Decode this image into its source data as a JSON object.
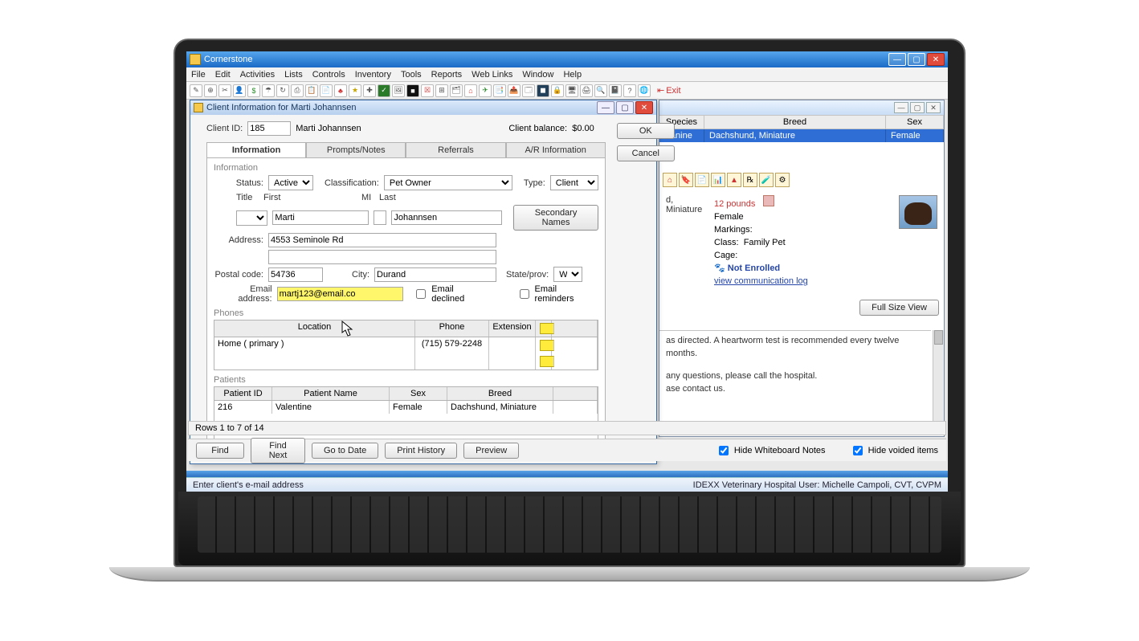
{
  "app": {
    "title": "Cornerstone"
  },
  "menu": [
    "File",
    "Edit",
    "Activities",
    "Lists",
    "Controls",
    "Inventory",
    "Tools",
    "Reports",
    "Web Links",
    "Window",
    "Help"
  ],
  "toolbar": {
    "exit": "Exit"
  },
  "child_window": {
    "columns": [
      "Species",
      "Breed",
      "Sex"
    ],
    "row": {
      "species": "Canine",
      "breed": "Dachshund, Miniature",
      "sex": "Female"
    },
    "breed_fragment": "d, Miniature",
    "pet": {
      "weight": "12 pounds",
      "sex": "Female",
      "markings_label": "Markings:",
      "class_label": "Class:",
      "class_value": "Family Pet",
      "cage_label": "Cage:",
      "not_enrolled": "Not Enrolled",
      "comm_log": "view communication log"
    },
    "full_size": "Full Size View",
    "notes": {
      "line1": "as directed.  A heartworm test is recommended every twelve months.",
      "line2": "any questions, please call the hospital.",
      "line3": "ase contact us."
    }
  },
  "dialog": {
    "title": "Client Information for Marti Johannsen",
    "client_id_label": "Client ID:",
    "client_id": "185",
    "client_name": "Marti Johannsen",
    "balance_label": "Client balance:",
    "balance_value": "$0.00",
    "ok": "OK",
    "cancel": "Cancel",
    "tabs": [
      "Information",
      "Prompts/Notes",
      "Referrals",
      "A/R Information"
    ],
    "info_legend": "Information",
    "status_label": "Status:",
    "status_value": "Active",
    "class_label": "Classification:",
    "class_value": "Pet Owner",
    "type_label": "Type:",
    "type_value": "Client",
    "title_label": "Title",
    "first_label": "First",
    "mi_label": "MI",
    "last_label": "Last",
    "first": "Marti",
    "mi": "",
    "last": "Johannsen",
    "secondary_names": "Secondary Names",
    "address_label": "Address:",
    "address1": "4553 Seminole Rd",
    "address2": "",
    "postal_label": "Postal code:",
    "postal": "54736",
    "city_label": "City:",
    "city": "Durand",
    "state_label": "State/prov:",
    "state": "WI",
    "email_label": "Email address:",
    "email": "martj123@email.co",
    "email_declined": "Email declined",
    "email_reminders": "Email reminders",
    "phones_legend": "Phones",
    "phones_cols": [
      "Location",
      "Phone",
      "Extension"
    ],
    "phones": [
      {
        "location": "Home  ( primary )",
        "phone": "(715) 579-2248",
        "ext": ""
      }
    ],
    "patients_legend": "Patients",
    "patients_cols": [
      "Patient ID",
      "Patient Name",
      "Sex",
      "Breed"
    ],
    "patients": [
      {
        "id": "216",
        "name": "Valentine",
        "sex": "Female",
        "breed": "Dachshund, Miniature"
      }
    ]
  },
  "footer": {
    "rows": "Rows 1 to 7 of 14",
    "find": "Find",
    "find_next": "Find Next",
    "go_to_date": "Go to Date",
    "print_history": "Print History",
    "preview": "Preview",
    "hide_wb": "Hide Whiteboard Notes",
    "hide_voided": "Hide voided items"
  },
  "status": {
    "left": "Enter client's e-mail address",
    "right": "IDEXX Veterinary Hospital    User: Michelle Campoli, CVT, CVPM"
  }
}
